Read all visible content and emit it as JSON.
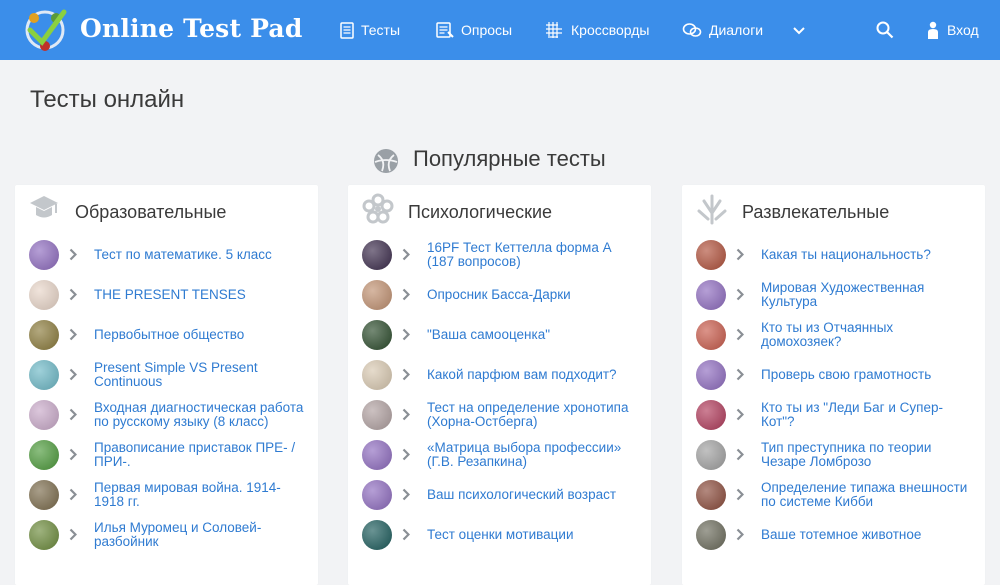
{
  "header": {
    "brand": "Online Test Pad",
    "nav": {
      "tests": "Тесты",
      "polls": "Опросы",
      "crosswords": "Кроссворды",
      "dialogs": "Диалоги",
      "login": "Вход"
    }
  },
  "colors": {
    "topbar": "#3b8eea",
    "link": "#2f7bd1",
    "background": "#f2f3f5"
  },
  "page_title": "Тесты онлайн",
  "section_title": "Популярные тесты",
  "columns": {
    "education": {
      "title": "Образовательные",
      "items": [
        {
          "label": "Тест по математике. 5 класс",
          "thumb": "#8e6bbf"
        },
        {
          "label": "THE PRESENT TENSES",
          "thumb": "#e8d5c8"
        },
        {
          "label": "Первобытное общество",
          "thumb": "#8a7a3a"
        },
        {
          "label": "Present Simple VS Present Continuous",
          "thumb": "#6cb8c6"
        },
        {
          "label": "Входная диагностическая работа по русскому языку (8 класс)",
          "thumb": "#c9a9c9"
        },
        {
          "label": "Правописание приставок ПРЕ- / ПРИ-.",
          "thumb": "#4c9a3a"
        },
        {
          "label": "Первая мировая война. 1914-1918 гг.",
          "thumb": "#7a6a4a"
        },
        {
          "label": "Илья Муромец и Соловей-разбойник",
          "thumb": "#6b8a3a"
        }
      ]
    },
    "psychology": {
      "title": "Психологические",
      "items": [
        {
          "label": "16PF Тест Кеттелла форма А (187 вопросов)",
          "thumb": "#3a2a4a"
        },
        {
          "label": "Опросник Басса-Дарки",
          "thumb": "#c09070"
        },
        {
          "label": "\"Ваша самооценка\"",
          "thumb": "#2a4a2a"
        },
        {
          "label": "Какой парфюм вам подходит?",
          "thumb": "#d8c8b0"
        },
        {
          "label": "Тест на определение хронотипа (Хорна-Остберга)",
          "thumb": "#b0a0a0"
        },
        {
          "label": "«Матрица выбора профессии» (Г.В. Резапкина)",
          "thumb": "#8e6bbf"
        },
        {
          "label": "Ваш психологический возраст",
          "thumb": "#8e6bbf"
        },
        {
          "label": "Тест оценки мотивации",
          "thumb": "#1a5a5a"
        }
      ]
    },
    "entertainment": {
      "title": "Развлекательные",
      "items": [
        {
          "label": "Какая ты национальность?",
          "thumb": "#b0503a"
        },
        {
          "label": "Мировая Художественная Культура",
          "thumb": "#8e6bbf"
        },
        {
          "label": "Кто ты из Отчаянных домохозяек?",
          "thumb": "#c85a4a"
        },
        {
          "label": "Проверь свою грамотность",
          "thumb": "#8e6bbf"
        },
        {
          "label": "Кто ты из \"Леди Баг и Супер-Кот\"?",
          "thumb": "#b03a5a"
        },
        {
          "label": "Тип преступника по теории Чезаре Ломброзо",
          "thumb": "#a0a0a0"
        },
        {
          "label": "Определение типажа внешности по системе Кибби",
          "thumb": "#8a4a3a"
        },
        {
          "label": "Ваше тотемное животное",
          "thumb": "#6a6a5a"
        }
      ]
    }
  }
}
